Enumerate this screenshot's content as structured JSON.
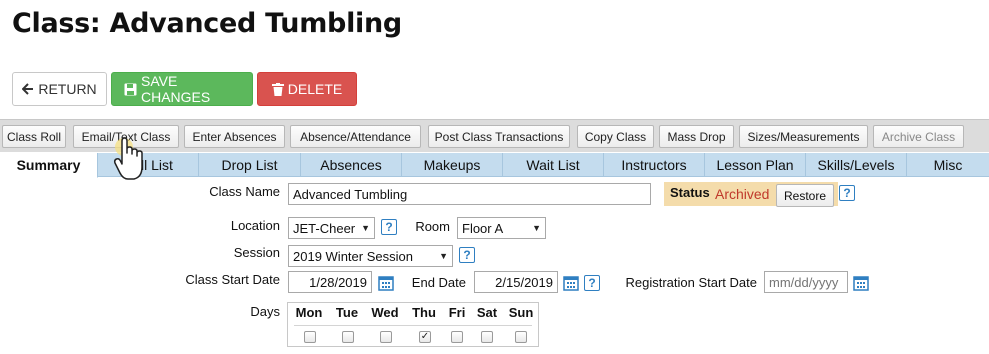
{
  "page": {
    "title": "Class: Advanced Tumbling"
  },
  "actions": {
    "return_label": "RETURN",
    "save_label": "SAVE CHANGES",
    "delete_label": "DELETE"
  },
  "toolbar": {
    "items": [
      {
        "label": "Class Roll",
        "enabled": true
      },
      {
        "label": "Email/Text Class",
        "enabled": true
      },
      {
        "label": "Enter Absences",
        "enabled": true
      },
      {
        "label": "Absence/Attendance",
        "enabled": true
      },
      {
        "label": "Post Class Transactions",
        "enabled": true
      },
      {
        "label": "Copy Class",
        "enabled": true
      },
      {
        "label": "Mass Drop",
        "enabled": true
      },
      {
        "label": "Sizes/Measurements",
        "enabled": true
      },
      {
        "label": "Archive Class",
        "enabled": false
      }
    ]
  },
  "tabs": [
    {
      "label": "Summary",
      "active": true
    },
    {
      "label": "Roll List",
      "active": false
    },
    {
      "label": "Drop List",
      "active": false
    },
    {
      "label": "Absences",
      "active": false
    },
    {
      "label": "Makeups",
      "active": false
    },
    {
      "label": "Wait List",
      "active": false
    },
    {
      "label": "Instructors",
      "active": false
    },
    {
      "label": "Lesson Plan",
      "active": false
    },
    {
      "label": "Skills/Levels",
      "active": false
    },
    {
      "label": "Misc",
      "active": false
    }
  ],
  "form": {
    "class_name": {
      "label": "Class Name",
      "value": "Advanced Tumbling"
    },
    "status": {
      "label": "Status",
      "value": "Archived",
      "restore_label": "Restore",
      "value_color": "#c0392b"
    },
    "location": {
      "label": "Location",
      "value": "JET-Cheer"
    },
    "room": {
      "label": "Room",
      "value": "Floor A"
    },
    "session": {
      "label": "Session",
      "value": "2019 Winter Session"
    },
    "class_start_date": {
      "label": "Class Start Date",
      "value": "1/28/2019"
    },
    "end_date": {
      "label": "End Date",
      "value": "2/15/2019"
    },
    "registration_start_date": {
      "label": "Registration Start Date",
      "value": "",
      "placeholder": "mm/dd/yyyy"
    },
    "days": {
      "label": "Days",
      "items": [
        {
          "label": "Mon",
          "checked": false
        },
        {
          "label": "Tue",
          "checked": false
        },
        {
          "label": "Wed",
          "checked": false
        },
        {
          "label": "Thu",
          "checked": true
        },
        {
          "label": "Fri",
          "checked": false
        },
        {
          "label": "Sat",
          "checked": false
        },
        {
          "label": "Sun",
          "checked": false
        }
      ]
    }
  },
  "colors": {
    "save": "#5cb85c",
    "delete": "#d9534f",
    "tab_bar": "#c4dcee",
    "status_bg": "#f4dcab",
    "help": "#2f7fc1"
  }
}
